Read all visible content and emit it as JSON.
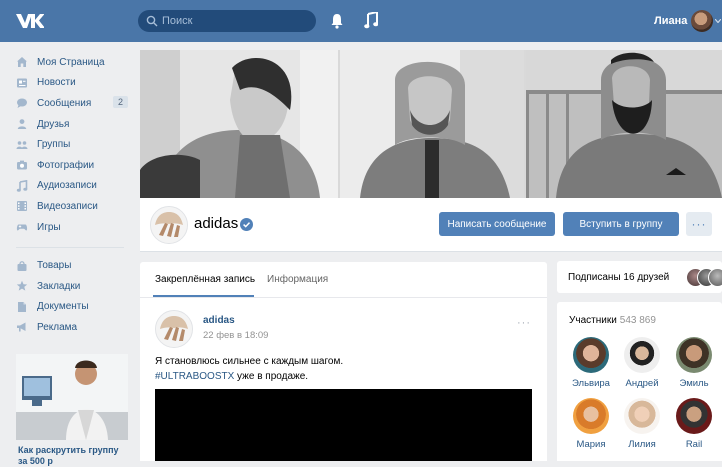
{
  "header": {
    "search_placeholder": "Поиск",
    "user_name": "Лиана",
    "brand_color": "#4a76a8"
  },
  "sidebar": {
    "items": [
      {
        "label": "Моя Страница",
        "icon": "home-icon"
      },
      {
        "label": "Новости",
        "icon": "news-icon"
      },
      {
        "label": "Сообщения",
        "icon": "messages-icon",
        "badge": "2"
      },
      {
        "label": "Друзья",
        "icon": "friends-icon"
      },
      {
        "label": "Группы",
        "icon": "groups-icon"
      },
      {
        "label": "Фотографии",
        "icon": "camera-icon"
      },
      {
        "label": "Аудиозаписи",
        "icon": "music-icon"
      },
      {
        "label": "Видеозаписи",
        "icon": "video-icon"
      },
      {
        "label": "Игры",
        "icon": "gamepad-icon"
      }
    ],
    "items2": [
      {
        "label": "Товары",
        "icon": "shopping-bag-icon"
      },
      {
        "label": "Закладки",
        "icon": "star-icon"
      },
      {
        "label": "Документы",
        "icon": "document-icon"
      },
      {
        "label": "Реклама",
        "icon": "megaphone-icon"
      }
    ],
    "promo_text": "Как раскрутить группу за 500 р"
  },
  "group": {
    "name": "adidas",
    "verified": true,
    "message_button": "Написать сообщение",
    "join_button": "Вступить в группу",
    "more_button": "···"
  },
  "wall": {
    "tabs": [
      "Закреплённая запись",
      "Информация"
    ],
    "active_tab": 0,
    "post": {
      "author": "adidas",
      "date": "22 фев в 18:09",
      "text_line1": "Я становлюсь сильнее с каждым шагом.",
      "hashtag": "#ULTRABOOSTX",
      "text_line2_rest": " уже в продаже.",
      "more": "···"
    }
  },
  "right": {
    "friends_text": "Подписаны 16 друзей",
    "members_title": "Участники",
    "members_count": "543 869",
    "members": [
      {
        "name": "Эльвира"
      },
      {
        "name": "Андрей"
      },
      {
        "name": "Эмиль"
      },
      {
        "name": "Мария"
      },
      {
        "name": "Лилия"
      },
      {
        "name": "Rail"
      }
    ]
  }
}
